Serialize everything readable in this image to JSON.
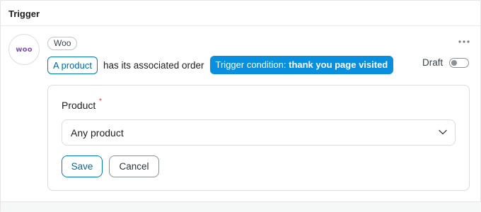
{
  "panel": {
    "title": "Trigger"
  },
  "integration": {
    "logo_text": "woo",
    "tag": "Woo"
  },
  "trigger": {
    "token_subject": "A product",
    "sentence": "has its associated order",
    "condition_label": "Trigger condition:",
    "condition_value": "thank you page visited"
  },
  "status": {
    "label": "Draft",
    "enabled": false
  },
  "form": {
    "field_label": "Product",
    "required_mark": "*",
    "select_value": "Any product",
    "save_label": "Save",
    "cancel_label": "Cancel"
  },
  "icons": {
    "more": "more-horizontal-icon",
    "chevron": "chevron-down-icon"
  },
  "colors": {
    "accent": "#007cba",
    "condition_bg": "#0a8fdf",
    "woo_purple": "#7f54b3"
  }
}
